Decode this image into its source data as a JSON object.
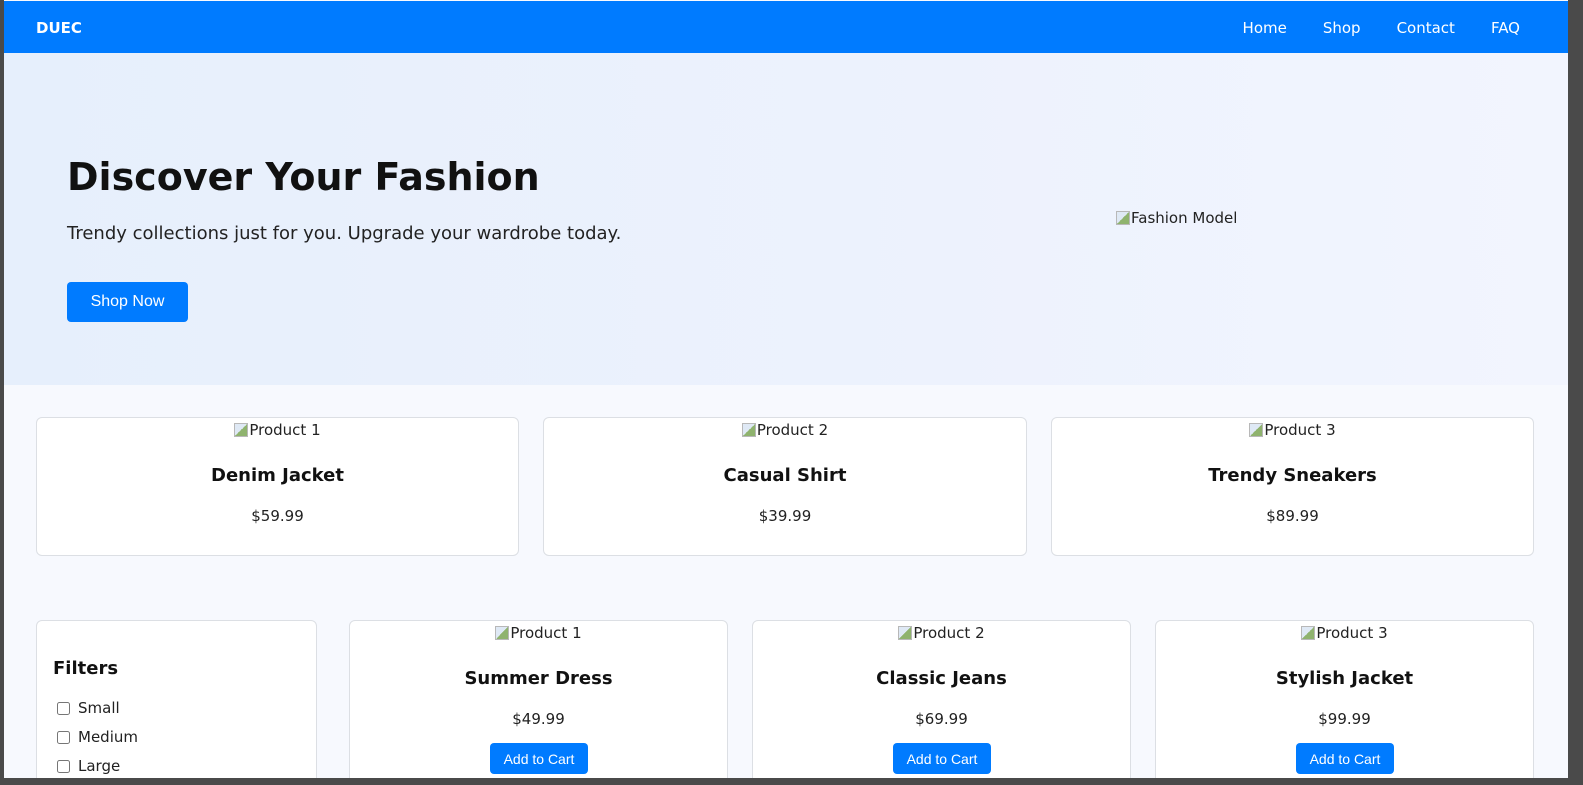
{
  "navbar": {
    "brand": "DUEC",
    "links": [
      "Home",
      "Shop",
      "Contact",
      "FAQ"
    ]
  },
  "hero": {
    "title": "Discover Your Fashion",
    "subtitle": "Trendy collections just for you. Upgrade your wardrobe today.",
    "button_label": "Shop Now",
    "image_alt": "Fashion Model"
  },
  "featured": [
    {
      "image_alt": "Product 1",
      "name": "Denim Jacket",
      "price": "$59.99"
    },
    {
      "image_alt": "Product 2",
      "name": "Casual Shirt",
      "price": "$39.99"
    },
    {
      "image_alt": "Product 3",
      "name": "Trendy Sneakers",
      "price": "$89.99"
    }
  ],
  "filters": {
    "title": "Filters",
    "options": [
      "Small",
      "Medium",
      "Large"
    ]
  },
  "products": [
    {
      "image_alt": "Product 1",
      "name": "Summer Dress",
      "price": "$49.99",
      "button_label": "Add to Cart"
    },
    {
      "image_alt": "Product 2",
      "name": "Classic Jeans",
      "price": "$69.99",
      "button_label": "Add to Cart"
    },
    {
      "image_alt": "Product 3",
      "name": "Stylish Jacket",
      "price": "$99.99",
      "button_label": "Add to Cart"
    }
  ],
  "colors": {
    "primary": "#007bff",
    "page_bg": "#f7f9fe",
    "card_border": "#dcdfe4"
  }
}
